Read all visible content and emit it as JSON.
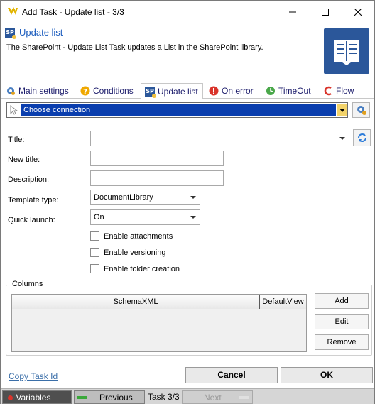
{
  "window": {
    "title": "Add Task - Update list - 3/3"
  },
  "header": {
    "title": "Update list",
    "description": "The SharePoint - Update List Task updates a List in the SharePoint library.",
    "badge": "SP"
  },
  "tabs": [
    {
      "label": "Main settings",
      "icon": "gear-icon"
    },
    {
      "label": "Conditions",
      "icon": "question-icon"
    },
    {
      "label": "Update list",
      "icon": "sharepoint-icon"
    },
    {
      "label": "On error",
      "icon": "error-icon"
    },
    {
      "label": "TimeOut",
      "icon": "timeout-icon"
    },
    {
      "label": "Flow",
      "icon": "flow-icon"
    }
  ],
  "connection": {
    "value": "Choose connection"
  },
  "form": {
    "title_label": "Title:",
    "title_value": "",
    "new_title_label": "New title:",
    "new_title_value": "",
    "description_label": "Description:",
    "description_value": "",
    "template_type_label": "Template type:",
    "template_type_value": "DocumentLibrary",
    "quick_launch_label": "Quick launch:",
    "quick_launch_value": "On",
    "enable_attachments": "Enable attachments",
    "enable_versioning": "Enable versioning",
    "enable_folder_creation": "Enable folder creation"
  },
  "columns": {
    "group_title": "Columns",
    "headers": [
      "SchemaXML",
      "DefaultView"
    ],
    "add_label": "Add",
    "edit_label": "Edit",
    "remove_label": "Remove"
  },
  "footer": {
    "copy_link": "Copy Task Id",
    "cancel_label": "Cancel",
    "ok_label": "OK"
  },
  "statusbar": {
    "variables_label": "Variables",
    "previous_label": "Previous",
    "task_counter": "Task 3/3",
    "next_label": "Next"
  },
  "colors": {
    "accent": "#0a3eae",
    "sharepoint": "#2b579a",
    "link": "#3a6ea8"
  }
}
